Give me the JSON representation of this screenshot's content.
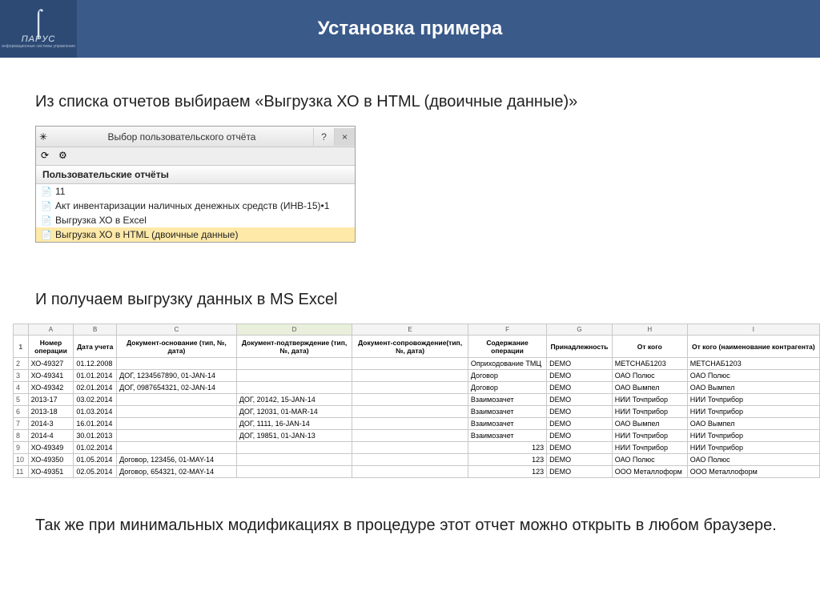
{
  "header": {
    "logo_name": "ΠΑΡУС",
    "logo_sub": "информационные системы управления",
    "title": "Установка примера"
  },
  "text": {
    "line1": "Из списка отчетов выбираем «Выгрузка ХО в HTML (двоичные данные)»",
    "line2": "И получаем выгрузку данных в MS Excel",
    "line3": "Так же при минимальных модификациях в процедуре этот отчет можно открыть в любом браузере."
  },
  "dialog": {
    "title": "Выбор пользовательского отчёта",
    "help": "?",
    "close": "×",
    "section": "Пользовательские отчёты",
    "items": [
      "11",
      "Акт инвентаризации наличных денежных средств (ИНВ-15)•1",
      "Выгрузка ХО в Excel",
      "Выгрузка ХО в HTML (двоичные данные)"
    ],
    "selected_index": 3
  },
  "excel": {
    "col_letters": [
      "",
      "A",
      "B",
      "C",
      "D",
      "E",
      "F",
      "G",
      "H",
      "I"
    ],
    "headers": [
      "Номер операции",
      "Дата учета",
      "Документ-основание (тип, №, дата)",
      "Документ-подтверждение (тип, №, дата)",
      "Документ-сопровождение(тип, №, дата)",
      "Содержание операции",
      "Принадлежность",
      "От кого",
      "От кого (наименование контрагента)"
    ],
    "rows": [
      [
        "ХО-49327",
        "01.12.2008",
        "",
        "",
        "",
        "Оприходование ТМЦ",
        "DEMO",
        "МЕТСНАБ1203",
        "МЕТСНАБ1203"
      ],
      [
        "ХО-49341",
        "01.01.2014",
        "ДОГ, 1234567890, 01-JAN-14",
        "",
        "",
        "Договор",
        "DEMO",
        "ОАО Полюс",
        "ОАО Полюс"
      ],
      [
        "ХО-49342",
        "02.01.2014",
        "ДОГ, 0987654321, 02-JAN-14",
        "",
        "",
        "Договор",
        "DEMO",
        "ОАО Вымпел",
        "ОАО Вымпел"
      ],
      [
        "2013-17",
        "03.02.2014",
        "",
        "ДОГ, 20142, 15-JAN-14",
        "",
        "Взаимозачет",
        "DEMO",
        "НИИ Точприбор",
        "НИИ Точприбор"
      ],
      [
        "2013-18",
        "01.03.2014",
        "",
        "ДОГ, 12031, 01-MAR-14",
        "",
        "Взаимозачет",
        "DEMO",
        "НИИ Точприбор",
        "НИИ Точприбор"
      ],
      [
        "2014-3",
        "16.01.2014",
        "",
        "ДОГ, 1111, 16-JAN-14",
        "",
        "Взаимозачет",
        "DEMO",
        "ОАО Вымпел",
        "ОАО Вымпел"
      ],
      [
        "2014-4",
        "30.01.2013",
        "",
        "ДОГ, 19851, 01-JAN-13",
        "",
        "Взаимозачет",
        "DEMO",
        "НИИ Точприбор",
        "НИИ Точприбор"
      ],
      [
        "ХО-49349",
        "01.02.2014",
        "",
        "",
        "",
        "123",
        "DEMO",
        "НИИ Точприбор",
        "НИИ Точприбор"
      ],
      [
        "ХО-49350",
        "01.05.2014",
        "Договор, 123456, 01-MAY-14",
        "",
        "",
        "123",
        "DEMO",
        "ОАО Полюс",
        "ОАО Полюс"
      ],
      [
        "ХО-49351",
        "02.05.2014",
        "Договор, 654321, 02-MAY-14",
        "",
        "",
        "123",
        "DEMO",
        "ООО Металлоформ",
        "ООО Металлоформ"
      ]
    ]
  }
}
